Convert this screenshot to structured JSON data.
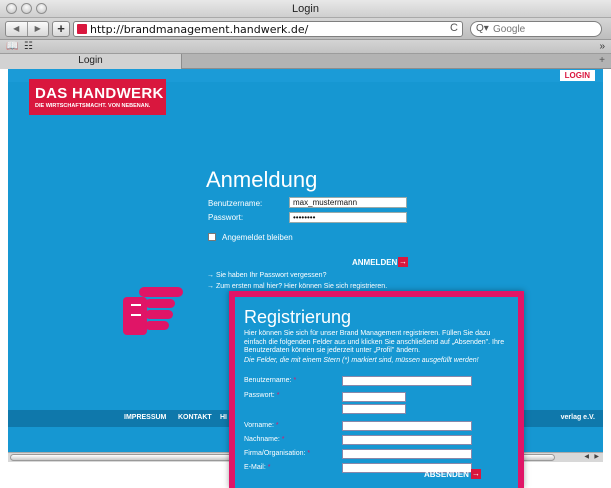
{
  "window": {
    "title": "Login"
  },
  "toolbar": {
    "back_glyph": "◀",
    "forward_glyph": "▶",
    "add_glyph": "+",
    "url": "http://brandmanagement.handwerk.de/",
    "reload_glyph": "C",
    "search_placeholder": "Google",
    "search_icon": "Q▾"
  },
  "bookmarks": {
    "book_icon": "book-icon",
    "book_glyph": "📖",
    "grid_glyph": "☷",
    "more_glyph": "»"
  },
  "tabs": [
    {
      "label": "Login"
    }
  ],
  "tab_add_glyph": "+",
  "page": {
    "login_link": "LOGIN",
    "logo": {
      "line1": "DAS HANDWERK",
      "line2": "DIE WIRTSCHAFTSMACHT. VON NEBENAN."
    },
    "heading": "Anmeldung",
    "username_label": "Benutzername:",
    "username_value": "max_mustermann",
    "password_label": "Passwort:",
    "password_value": "••••••••",
    "remember_label": "Angemeldet bleiben",
    "submit_label": "ANMELDEN",
    "arrow_glyph": "→",
    "forgot_link": "Sie haben Ihr Passwort vergessen?",
    "register_link": "Zum ersten mal hier? Hier können Sie sich registrieren.",
    "footer": {
      "impressum": "IMPRESSUM",
      "kontakt": "KONTAKT",
      "cut": "HI",
      "right": "verlag e.V."
    }
  },
  "registration": {
    "title": "Registrierung",
    "text": "Hier können Sie sich für unser Brand Management registrieren. Füllen Sie dazu einfach die folgenden Felder aus und klicken Sie anschließend auf „Absenden\". Ihre Benutzerdaten können sie jederzeit unter „Profil\" ändern.",
    "note": "Die Felder, die mit einem Stern (*) markiert sind, müssen ausgefüllt werden!",
    "fields": [
      {
        "label": "Benutzername:"
      },
      {
        "label": "Passwort:"
      },
      {
        "label": "Vorname:"
      },
      {
        "label": "Nachname:"
      },
      {
        "label": "Firma/Organisation:"
      },
      {
        "label": "E-Mail:"
      }
    ],
    "star": "*",
    "submit_label": "ABSENDEN"
  },
  "colors": {
    "page_blue": "#1697d2",
    "brand_red": "#d9173e",
    "overlay_pink": "#e01567"
  }
}
